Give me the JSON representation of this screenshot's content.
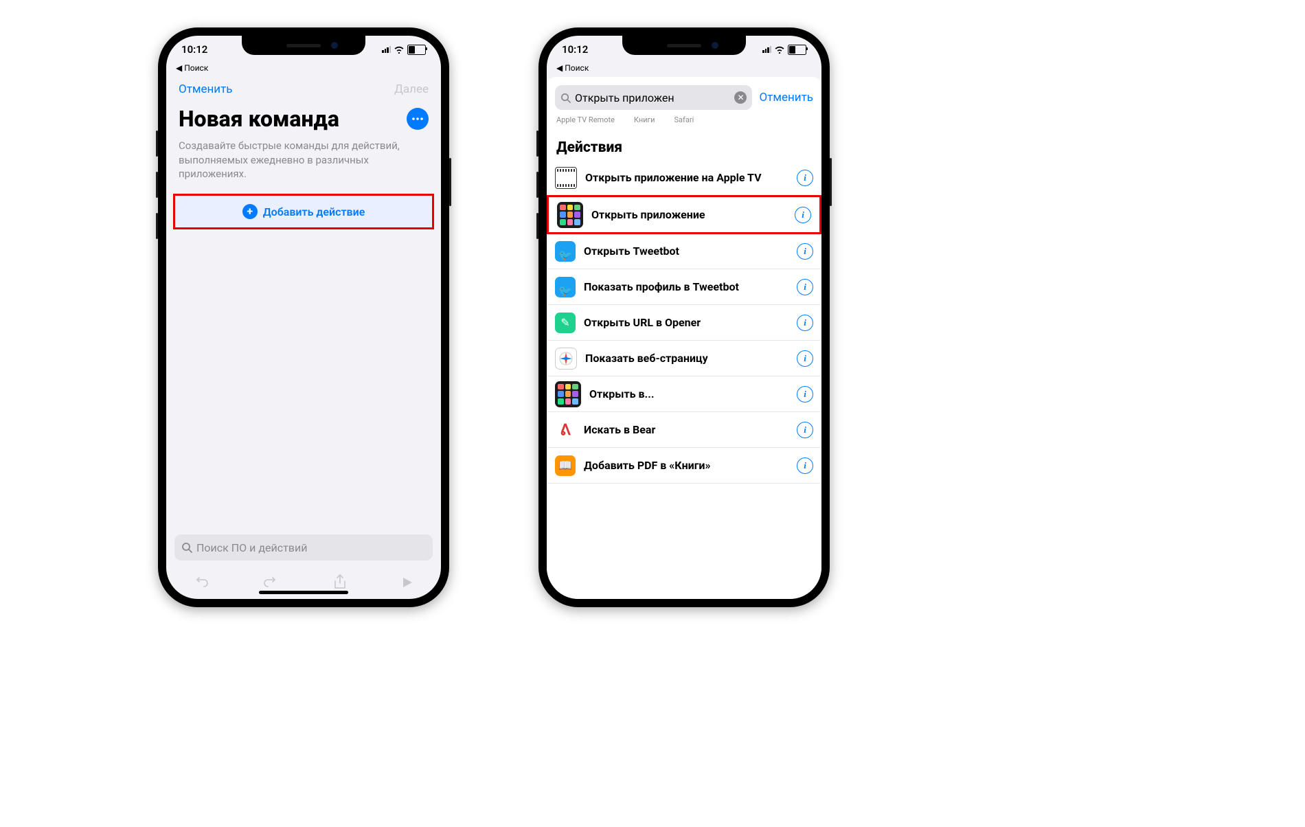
{
  "status": {
    "time": "10:12",
    "back": "◀ Поиск"
  },
  "screen1": {
    "cancel": "Отменить",
    "next": "Далее",
    "title": "Новая команда",
    "subtitle": "Создавайте быстрые команды для действий, выполняемых ежедневно в различных приложениях.",
    "add": "Добавить действие",
    "search_ph": "Поиск ПО и действий"
  },
  "screen2": {
    "query": "Открыть приложен",
    "cancel": "Отменить",
    "suggestions": [
      "Apple TV Remote",
      "Книги",
      "Safari"
    ],
    "section": "Действия",
    "rows": [
      {
        "label": "Открыть приложение на Apple TV",
        "icon": "film",
        "hl": false
      },
      {
        "label": "Открыть приложение",
        "icon": "grid",
        "hl": true
      },
      {
        "label": "Открыть Tweetbot",
        "icon": "tw",
        "hl": false
      },
      {
        "label": "Показать профиль в Tweetbot",
        "icon": "tw",
        "hl": false
      },
      {
        "label": "Открыть URL в Opener",
        "icon": "open",
        "hl": false
      },
      {
        "label": "Показать веб-страницу",
        "icon": "saf",
        "hl": false
      },
      {
        "label": "Открыть в...",
        "icon": "grid",
        "hl": false
      },
      {
        "label": "Искать в Bear",
        "icon": "bear",
        "hl": false
      },
      {
        "label": "Добавить PDF в «Книги»",
        "icon": "book",
        "hl": false
      }
    ]
  }
}
